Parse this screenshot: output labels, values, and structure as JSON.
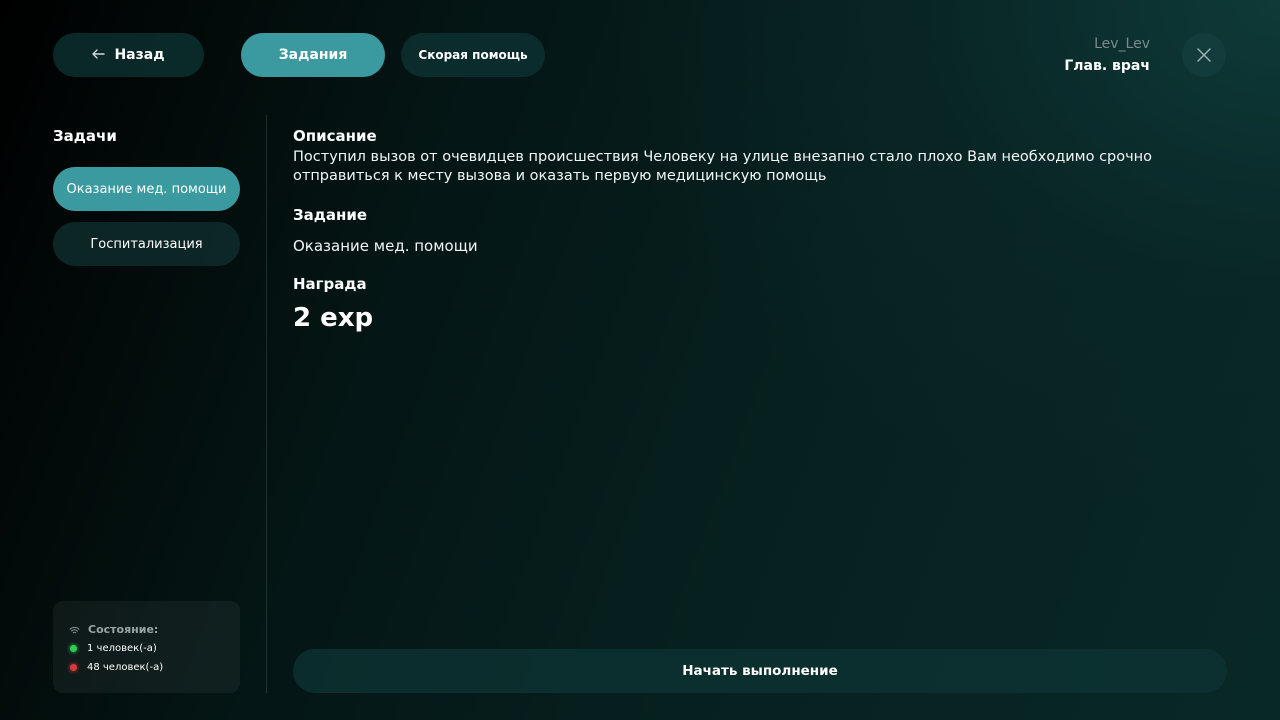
{
  "header": {
    "back_label": "Назад",
    "tabs": [
      {
        "label": "Задания",
        "active": true
      },
      {
        "label": "Скорая помощь",
        "active": false
      }
    ],
    "user": {
      "name": "Lev_Lev",
      "role": "Глав. врач"
    }
  },
  "sidebar": {
    "title": "Задачи",
    "items": [
      {
        "label": "Оказание мед. помощи",
        "active": true
      },
      {
        "label": "Госпитализация",
        "active": false
      }
    ],
    "status": {
      "label": "Состояние:",
      "rows": [
        {
          "text": "1 человек(-а)",
          "color": "#2ecc55"
        },
        {
          "text": "48 человек(-а)",
          "color": "#d63a3a"
        }
      ]
    }
  },
  "main": {
    "description_title": "Описание",
    "description_text": "Поступил вызов от очевидцев происшествия Человеку на улице внезапно стало плохо Вам необходимо срочно отправиться к месту вызова и оказать первую медицинскую помощь",
    "task_title": "Задание",
    "task_value": "Оказание мед. помощи",
    "reward_title": "Награда",
    "reward_value": "2 exp",
    "start_label": "Начать выполнение"
  },
  "colors": {
    "accent": "#3a9aa0",
    "online": "#2ecc55",
    "offline": "#d63a3a"
  }
}
